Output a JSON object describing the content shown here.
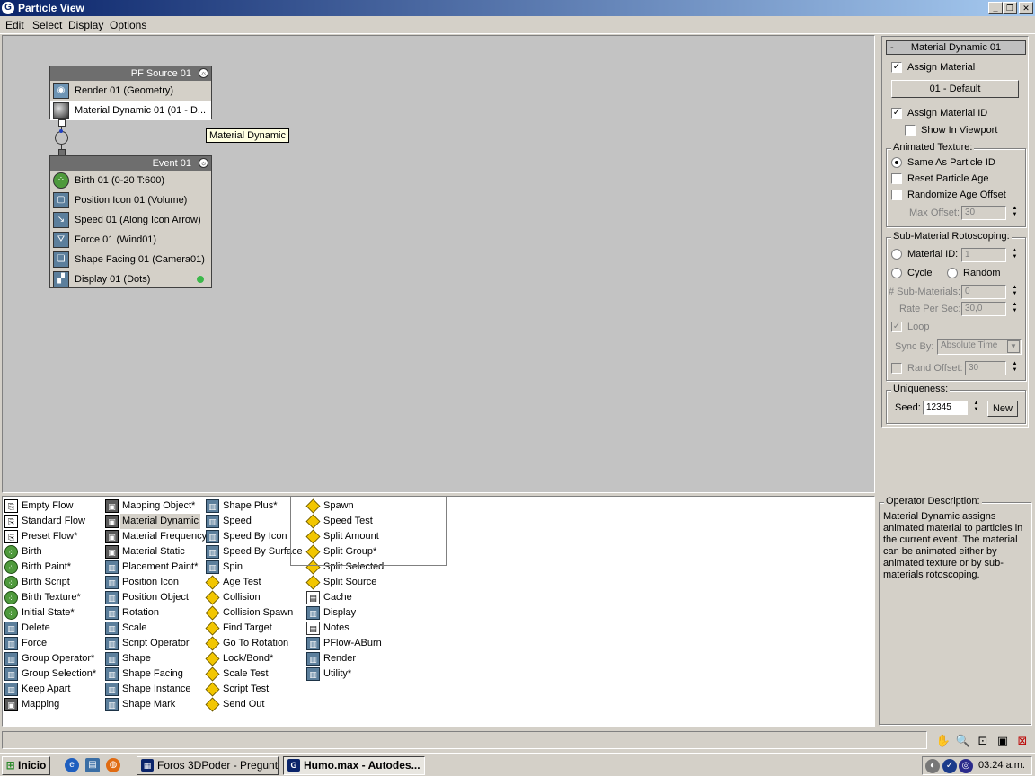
{
  "window": {
    "title": "Particle View"
  },
  "menu": [
    "Edit",
    "Select",
    "Display",
    "Options"
  ],
  "graph": {
    "source_node": {
      "title": "PF Source 01",
      "items": [
        {
          "label": "Render 01 (Geometry)",
          "icon": "render-teapot-icon"
        },
        {
          "label": "Material Dynamic 01 (01 - D...",
          "icon": "material-sphere-icon",
          "selected": true
        }
      ]
    },
    "event_node": {
      "title": "Event 01",
      "items": [
        {
          "label": "Birth 01 (0-20 T:600)",
          "icon": "birth-icon"
        },
        {
          "label": "Position Icon 01 (Volume)",
          "icon": "position-icon"
        },
        {
          "label": "Speed 01 (Along Icon Arrow)",
          "icon": "speed-icon"
        },
        {
          "label": "Force 01 (Wind01)",
          "icon": "force-icon"
        },
        {
          "label": "Shape Facing 01 (Camera01)",
          "icon": "shape-facing-icon"
        },
        {
          "label": "Display 01 (Dots)",
          "icon": "display-icon"
        }
      ]
    },
    "tooltip": "Material Dynamic"
  },
  "depot": {
    "columns": [
      [
        {
          "label": "Empty Flow",
          "kind": "flow"
        },
        {
          "label": "Standard Flow",
          "kind": "flow"
        },
        {
          "label": "Preset Flow*",
          "kind": "flow"
        },
        {
          "label": "Birth",
          "kind": "green"
        },
        {
          "label": "Birth Paint*",
          "kind": "green"
        },
        {
          "label": "Birth Script",
          "kind": "green"
        },
        {
          "label": "Birth Texture*",
          "kind": "green"
        },
        {
          "label": "Initial State*",
          "kind": "green"
        },
        {
          "label": "Delete",
          "kind": "opb"
        },
        {
          "label": "Force",
          "kind": "opb"
        },
        {
          "label": "Group Operator*",
          "kind": "opb"
        },
        {
          "label": "Group Selection*",
          "kind": "opb"
        },
        {
          "label": "Keep Apart",
          "kind": "opb"
        },
        {
          "label": "Mapping",
          "kind": "op"
        }
      ],
      [
        {
          "label": "Mapping Object*",
          "kind": "op"
        },
        {
          "label": "Material Dynamic",
          "kind": "op",
          "highlight": true
        },
        {
          "label": "Material Frequency",
          "kind": "op"
        },
        {
          "label": "Material Static",
          "kind": "op"
        },
        {
          "label": "Placement Paint*",
          "kind": "opb"
        },
        {
          "label": "Position Icon",
          "kind": "opb"
        },
        {
          "label": "Position Object",
          "kind": "opb"
        },
        {
          "label": "Rotation",
          "kind": "opb"
        },
        {
          "label": "Scale",
          "kind": "opb"
        },
        {
          "label": "Script Operator",
          "kind": "opb"
        },
        {
          "label": "Shape",
          "kind": "opb"
        },
        {
          "label": "Shape Facing",
          "kind": "opb"
        },
        {
          "label": "Shape Instance",
          "kind": "opb"
        },
        {
          "label": "Shape Mark",
          "kind": "opb"
        }
      ],
      [
        {
          "label": "Shape Plus*",
          "kind": "opb"
        },
        {
          "label": "Speed",
          "kind": "opb"
        },
        {
          "label": "Speed By Icon",
          "kind": "opb"
        },
        {
          "label": "Speed By Surface",
          "kind": "opb"
        },
        {
          "label": "Spin",
          "kind": "opb"
        },
        {
          "label": "Age Test",
          "kind": "test"
        },
        {
          "label": "Collision",
          "kind": "test"
        },
        {
          "label": "Collision Spawn",
          "kind": "test"
        },
        {
          "label": "Find Target",
          "kind": "test"
        },
        {
          "label": "Go To Rotation",
          "kind": "test"
        },
        {
          "label": "Lock/Bond*",
          "kind": "test"
        },
        {
          "label": "Scale Test",
          "kind": "test"
        },
        {
          "label": "Script Test",
          "kind": "test"
        },
        {
          "label": "Send Out",
          "kind": "test"
        }
      ],
      [
        {
          "label": "Spawn",
          "kind": "test"
        },
        {
          "label": "Speed Test",
          "kind": "test"
        },
        {
          "label": "Split Amount",
          "kind": "test"
        },
        {
          "label": "Split Group*",
          "kind": "test"
        },
        {
          "label": "Split Selected",
          "kind": "test"
        },
        {
          "label": "Split Source",
          "kind": "test"
        },
        {
          "label": "Cache",
          "kind": "flag"
        },
        {
          "label": "Display",
          "kind": "opb"
        },
        {
          "label": "Notes",
          "kind": "flag"
        },
        {
          "label": "PFlow-ABurn",
          "kind": "opb"
        },
        {
          "label": "Render",
          "kind": "opb"
        },
        {
          "label": "Utility*",
          "kind": "opb"
        }
      ]
    ]
  },
  "rollout": {
    "minus": "-",
    "title": "Material Dynamic 01",
    "assign_material": "Assign Material",
    "material_button": "01 - Default",
    "assign_material_id": "Assign Material ID",
    "show_in_viewport": "Show In Viewport",
    "animated_texture": {
      "title": "Animated Texture:",
      "same_as_particle_id": "Same As Particle ID",
      "reset_particle_age": "Reset Particle Age",
      "randomize_age_offset": "Randomize Age Offset",
      "max_offset_label": "Max Offset:",
      "max_offset_value": "30"
    },
    "submaterial": {
      "title": "Sub-Material Rotoscoping:",
      "material_id_label": "Material ID:",
      "material_id_value": "1",
      "cycle": "Cycle",
      "random": "Random",
      "num_submaterials_label": "# Sub-Materials:",
      "num_submaterials_value": "0",
      "rate_label": "Rate Per Sec:",
      "rate_value": "30,0",
      "loop": "Loop",
      "sync_by_label": "Sync By:",
      "sync_by_value": "Absolute Time",
      "rand_offset_label": "Rand Offset:",
      "rand_offset_value": "30"
    },
    "uniqueness": {
      "title": "Uniqueness:",
      "seed_label": "Seed:",
      "seed_value": "12345",
      "new_button": "New"
    }
  },
  "description": {
    "title": "Operator Description:",
    "text": "Material Dynamic assigns animated material to particles in the current event. The material can be animated either by animated texture or by sub-materials rotoscoping."
  },
  "taskbar": {
    "start": "Inicio",
    "tasks": [
      "Foros 3DPoder - Pregunt...",
      "Humo.max - Autodes..."
    ],
    "clock": "03:24 a.m."
  }
}
